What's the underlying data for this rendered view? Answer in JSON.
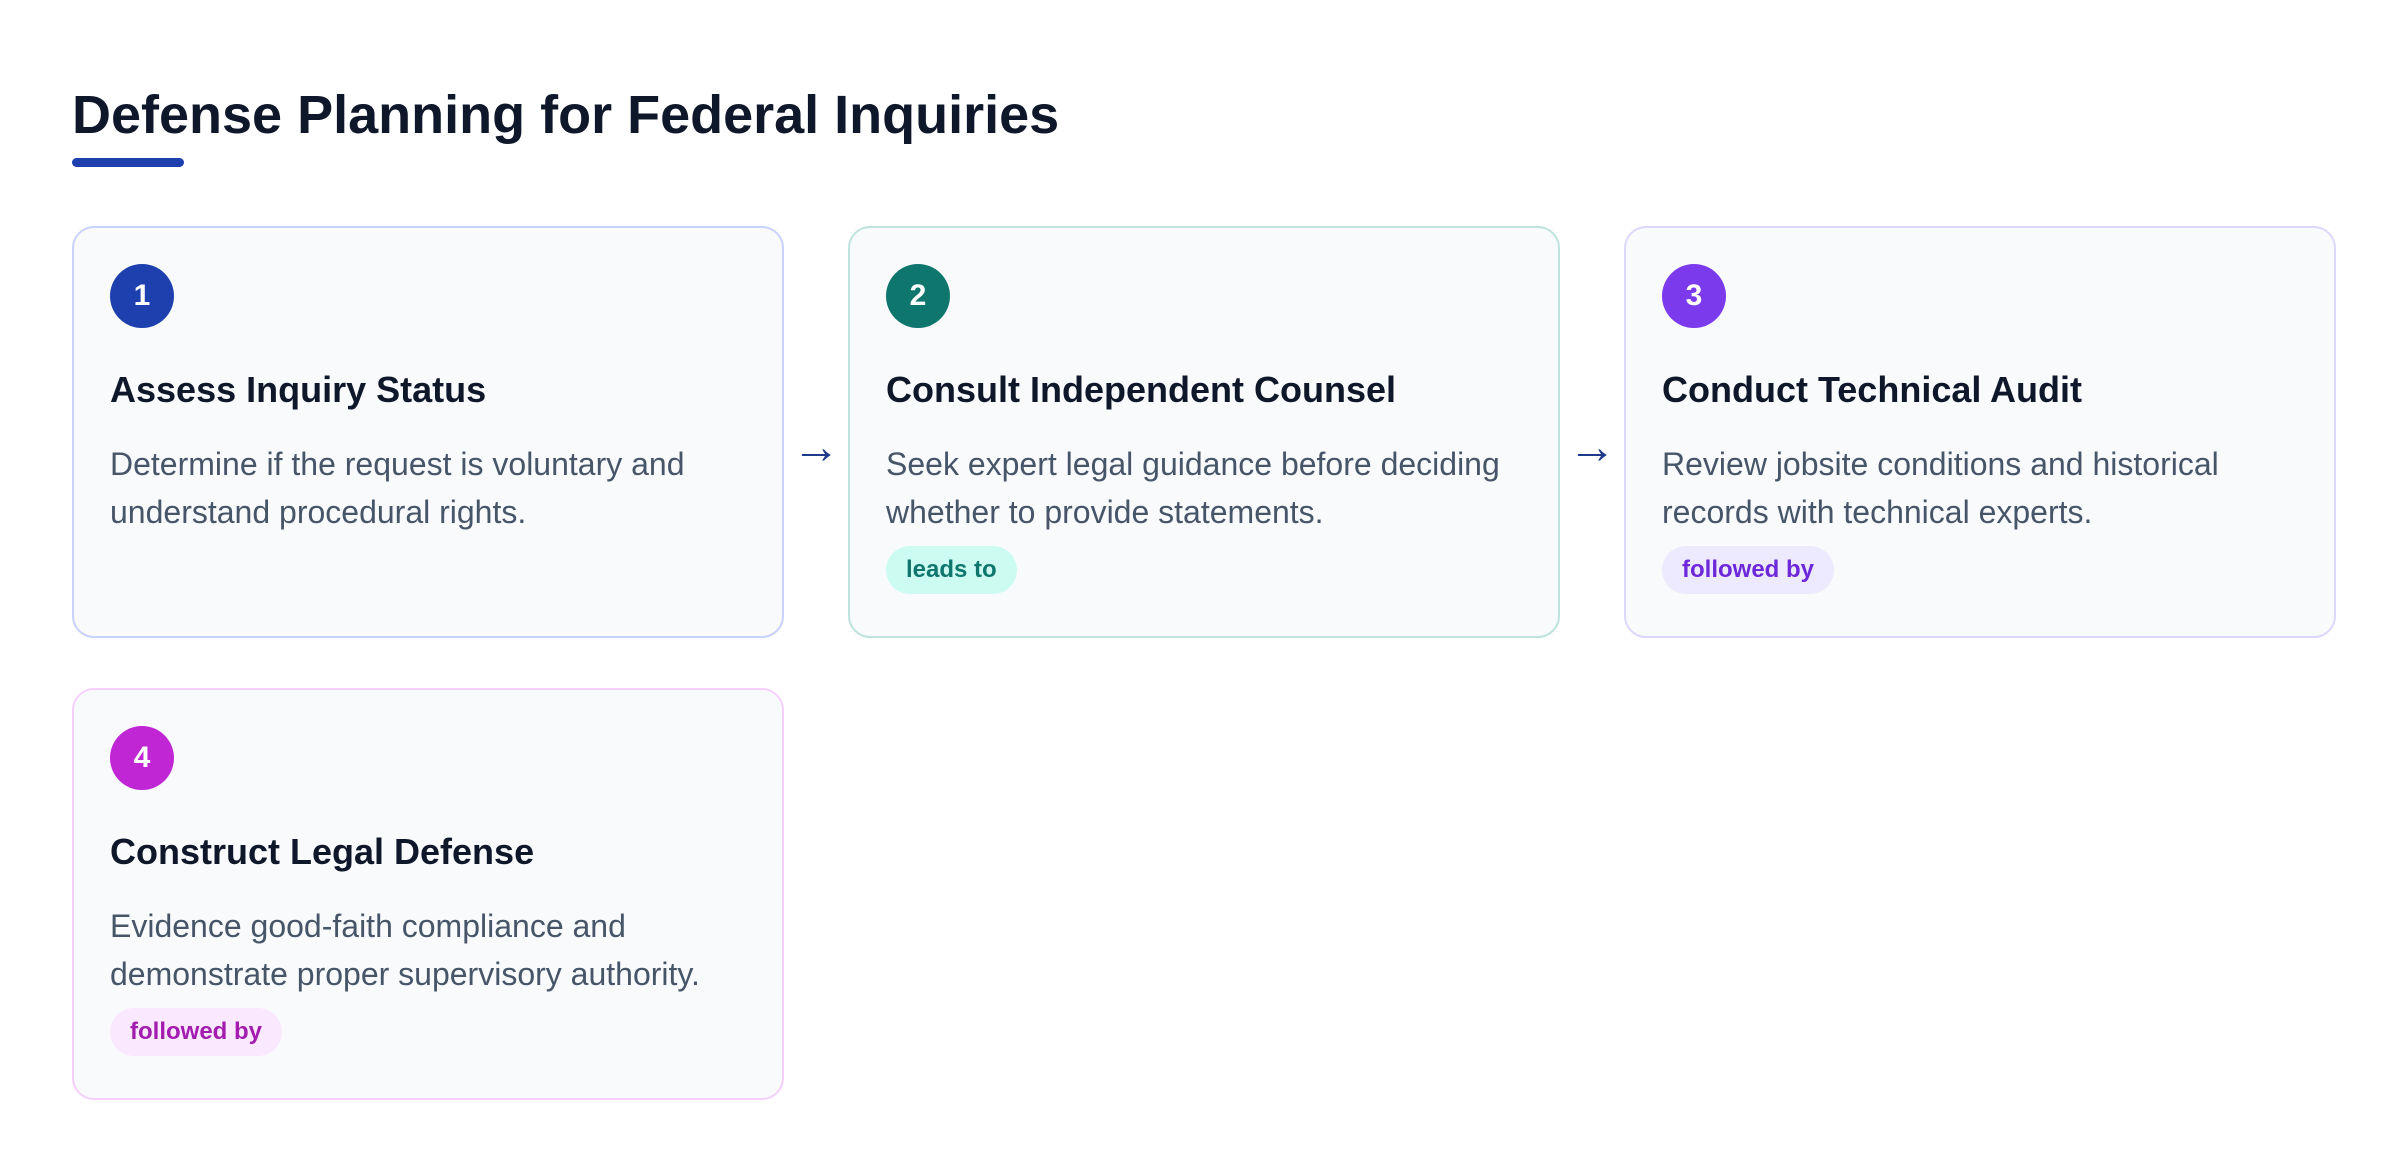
{
  "title": "Defense Planning for Federal Inquiries",
  "colors": {
    "accent": "#1e40af",
    "step1": "#1e40af",
    "step2": "#0f766e",
    "step3": "#7c3aed",
    "step4": "#c026d3"
  },
  "connector_icon": "→",
  "steps": [
    {
      "number": "1",
      "title": "Assess Inquiry Status",
      "description": "Determine if the request is voluntary and understand procedural rights."
    },
    {
      "number": "2",
      "title": "Consult Independent Counsel",
      "description": "Seek expert legal guidance before deciding whether to provide statements.",
      "tag": "leads to"
    },
    {
      "number": "3",
      "title": "Conduct Technical Audit",
      "description": "Review jobsite conditions and historical records with technical experts.",
      "tag": "followed by"
    },
    {
      "number": "4",
      "title": "Construct Legal Defense",
      "description": "Evidence good-faith compliance and demonstrate proper supervisory authority.",
      "tag": "followed by"
    }
  ]
}
